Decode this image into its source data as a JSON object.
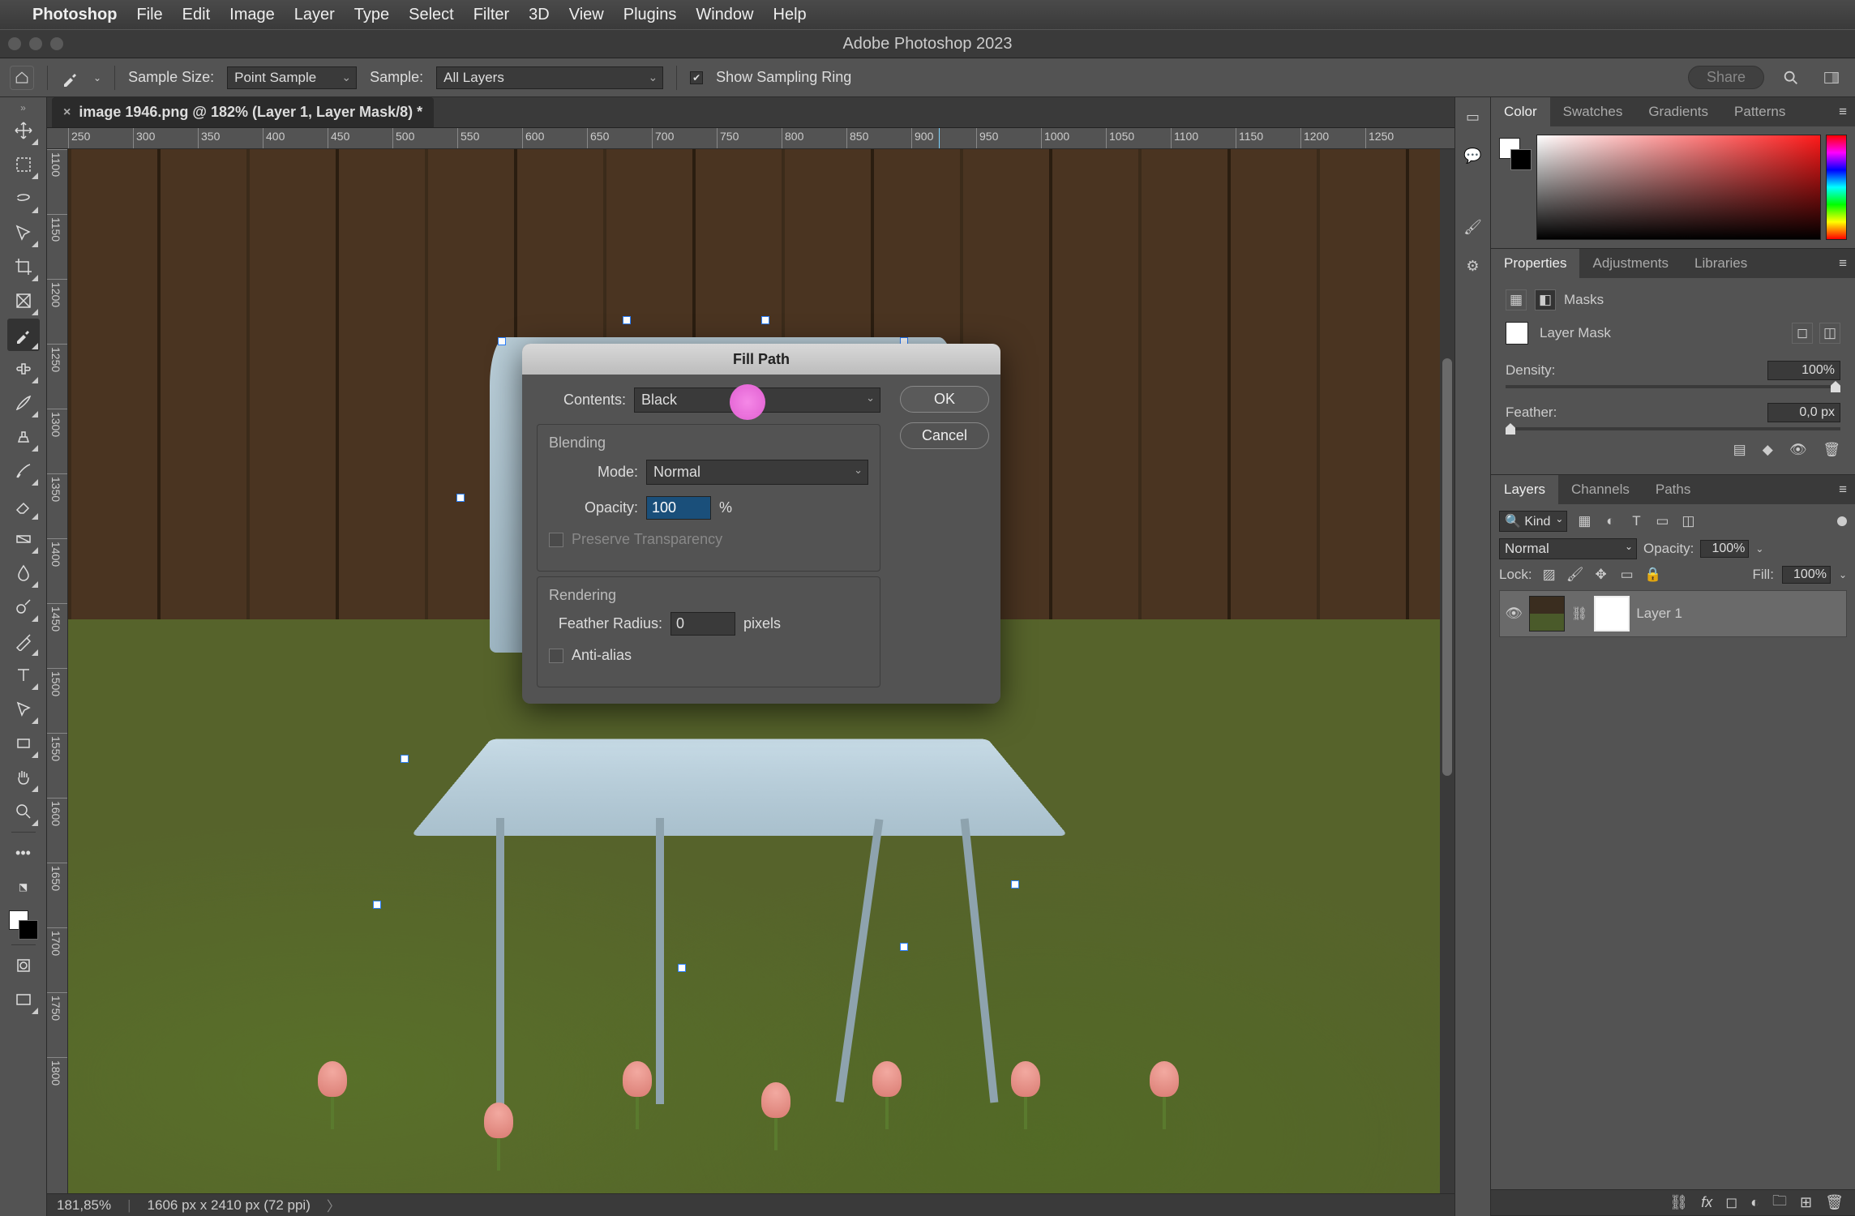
{
  "mac_menu": {
    "app": "Photoshop",
    "items": [
      "File",
      "Edit",
      "Image",
      "Layer",
      "Type",
      "Select",
      "Filter",
      "3D",
      "View",
      "Plugins",
      "Window",
      "Help"
    ]
  },
  "window_title": "Adobe Photoshop 2023",
  "options_bar": {
    "sample_size_label": "Sample Size:",
    "sample_size_value": "Point Sample",
    "sample_label": "Sample:",
    "sample_value": "All Layers",
    "show_sampling_ring": "Show Sampling Ring",
    "share": "Share"
  },
  "document": {
    "tab_title": "image 1946.png @ 182% (Layer 1, Layer Mask/8) *",
    "ruler_h": [
      "250",
      "300",
      "350",
      "400",
      "450",
      "500",
      "550",
      "600",
      "650",
      "700",
      "750",
      "800",
      "850",
      "900",
      "950",
      "1000",
      "1050",
      "1100",
      "1150",
      "1200",
      "1250"
    ],
    "ruler_v": [
      "1100",
      "1150",
      "1200",
      "1250",
      "1300",
      "1350",
      "1400",
      "1450",
      "1500",
      "1550",
      "1600",
      "1650",
      "1700",
      "1750",
      "1800"
    ]
  },
  "status_bar": {
    "zoom": "181,85%",
    "doc_info": "1606 px x 2410 px (72 ppi)"
  },
  "panels": {
    "color_tabs": [
      "Color",
      "Swatches",
      "Gradients",
      "Patterns"
    ],
    "props_tabs": [
      "Properties",
      "Adjustments",
      "Libraries"
    ],
    "masks_label": "Masks",
    "layer_mask_label": "Layer Mask",
    "density_label": "Density:",
    "density_value": "100%",
    "feather_label": "Feather:",
    "feather_value": "0,0 px",
    "layers_tabs": [
      "Layers",
      "Channels",
      "Paths"
    ],
    "kind_label": "Kind",
    "blend_mode": "Normal",
    "opacity_label": "Opacity:",
    "opacity_value": "100%",
    "lock_label": "Lock:",
    "fill_label": "Fill:",
    "fill_value": "100%",
    "layer_name": "Layer 1"
  },
  "dialog": {
    "title": "Fill Path",
    "contents_label": "Contents:",
    "contents_value": "Black",
    "ok": "OK",
    "cancel": "Cancel",
    "blending_legend": "Blending",
    "mode_label": "Mode:",
    "mode_value": "Normal",
    "opacity_label": "Opacity:",
    "opacity_value": "100",
    "opacity_unit": "%",
    "preserve_transparency": "Preserve Transparency",
    "rendering_legend": "Rendering",
    "feather_radius_label": "Feather Radius:",
    "feather_radius_value": "0",
    "feather_radius_unit": "pixels",
    "anti_alias": "Anti-alias"
  }
}
